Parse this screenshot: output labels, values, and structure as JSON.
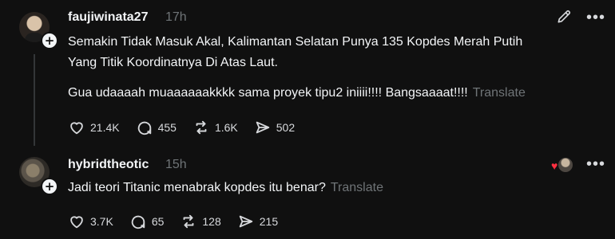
{
  "posts": [
    {
      "username": "faujiwinata27",
      "time": "17h",
      "lines": [
        "Semakin Tidak Masuk Akal, Kalimantan Selatan Punya 135 Kopdes Merah Putih",
        "Yang Titik Koordinatnya Di Atas Laut.",
        "Gua udaaaah muaaaaaakkkk sama proyek tipu2 iniiii!!!! Bangsaaaat!!!!"
      ],
      "translate": "Translate",
      "stats": {
        "likes": "21.4K",
        "replies": "455",
        "reposts": "1.6K",
        "shares": "502"
      }
    },
    {
      "username": "hybridtheotic",
      "time": "15h",
      "lines": [
        "Jadi teori Titanic menabrak kopdes itu benar?"
      ],
      "translate": "Translate",
      "stats": {
        "likes": "3.7K",
        "replies": "65",
        "reposts": "128",
        "shares": "215"
      }
    }
  ],
  "ui": {
    "follow_glyph": "+",
    "more_glyph": "•••",
    "heart_glyph": "♥",
    "colors": {
      "background": "#101010",
      "text": "#f3f5f7",
      "muted": "#6f7477",
      "like_red": "#ff3040"
    },
    "icons": [
      "heart-icon",
      "reply-icon",
      "repost-icon",
      "share-icon",
      "edit-icon",
      "more-icon"
    ]
  }
}
